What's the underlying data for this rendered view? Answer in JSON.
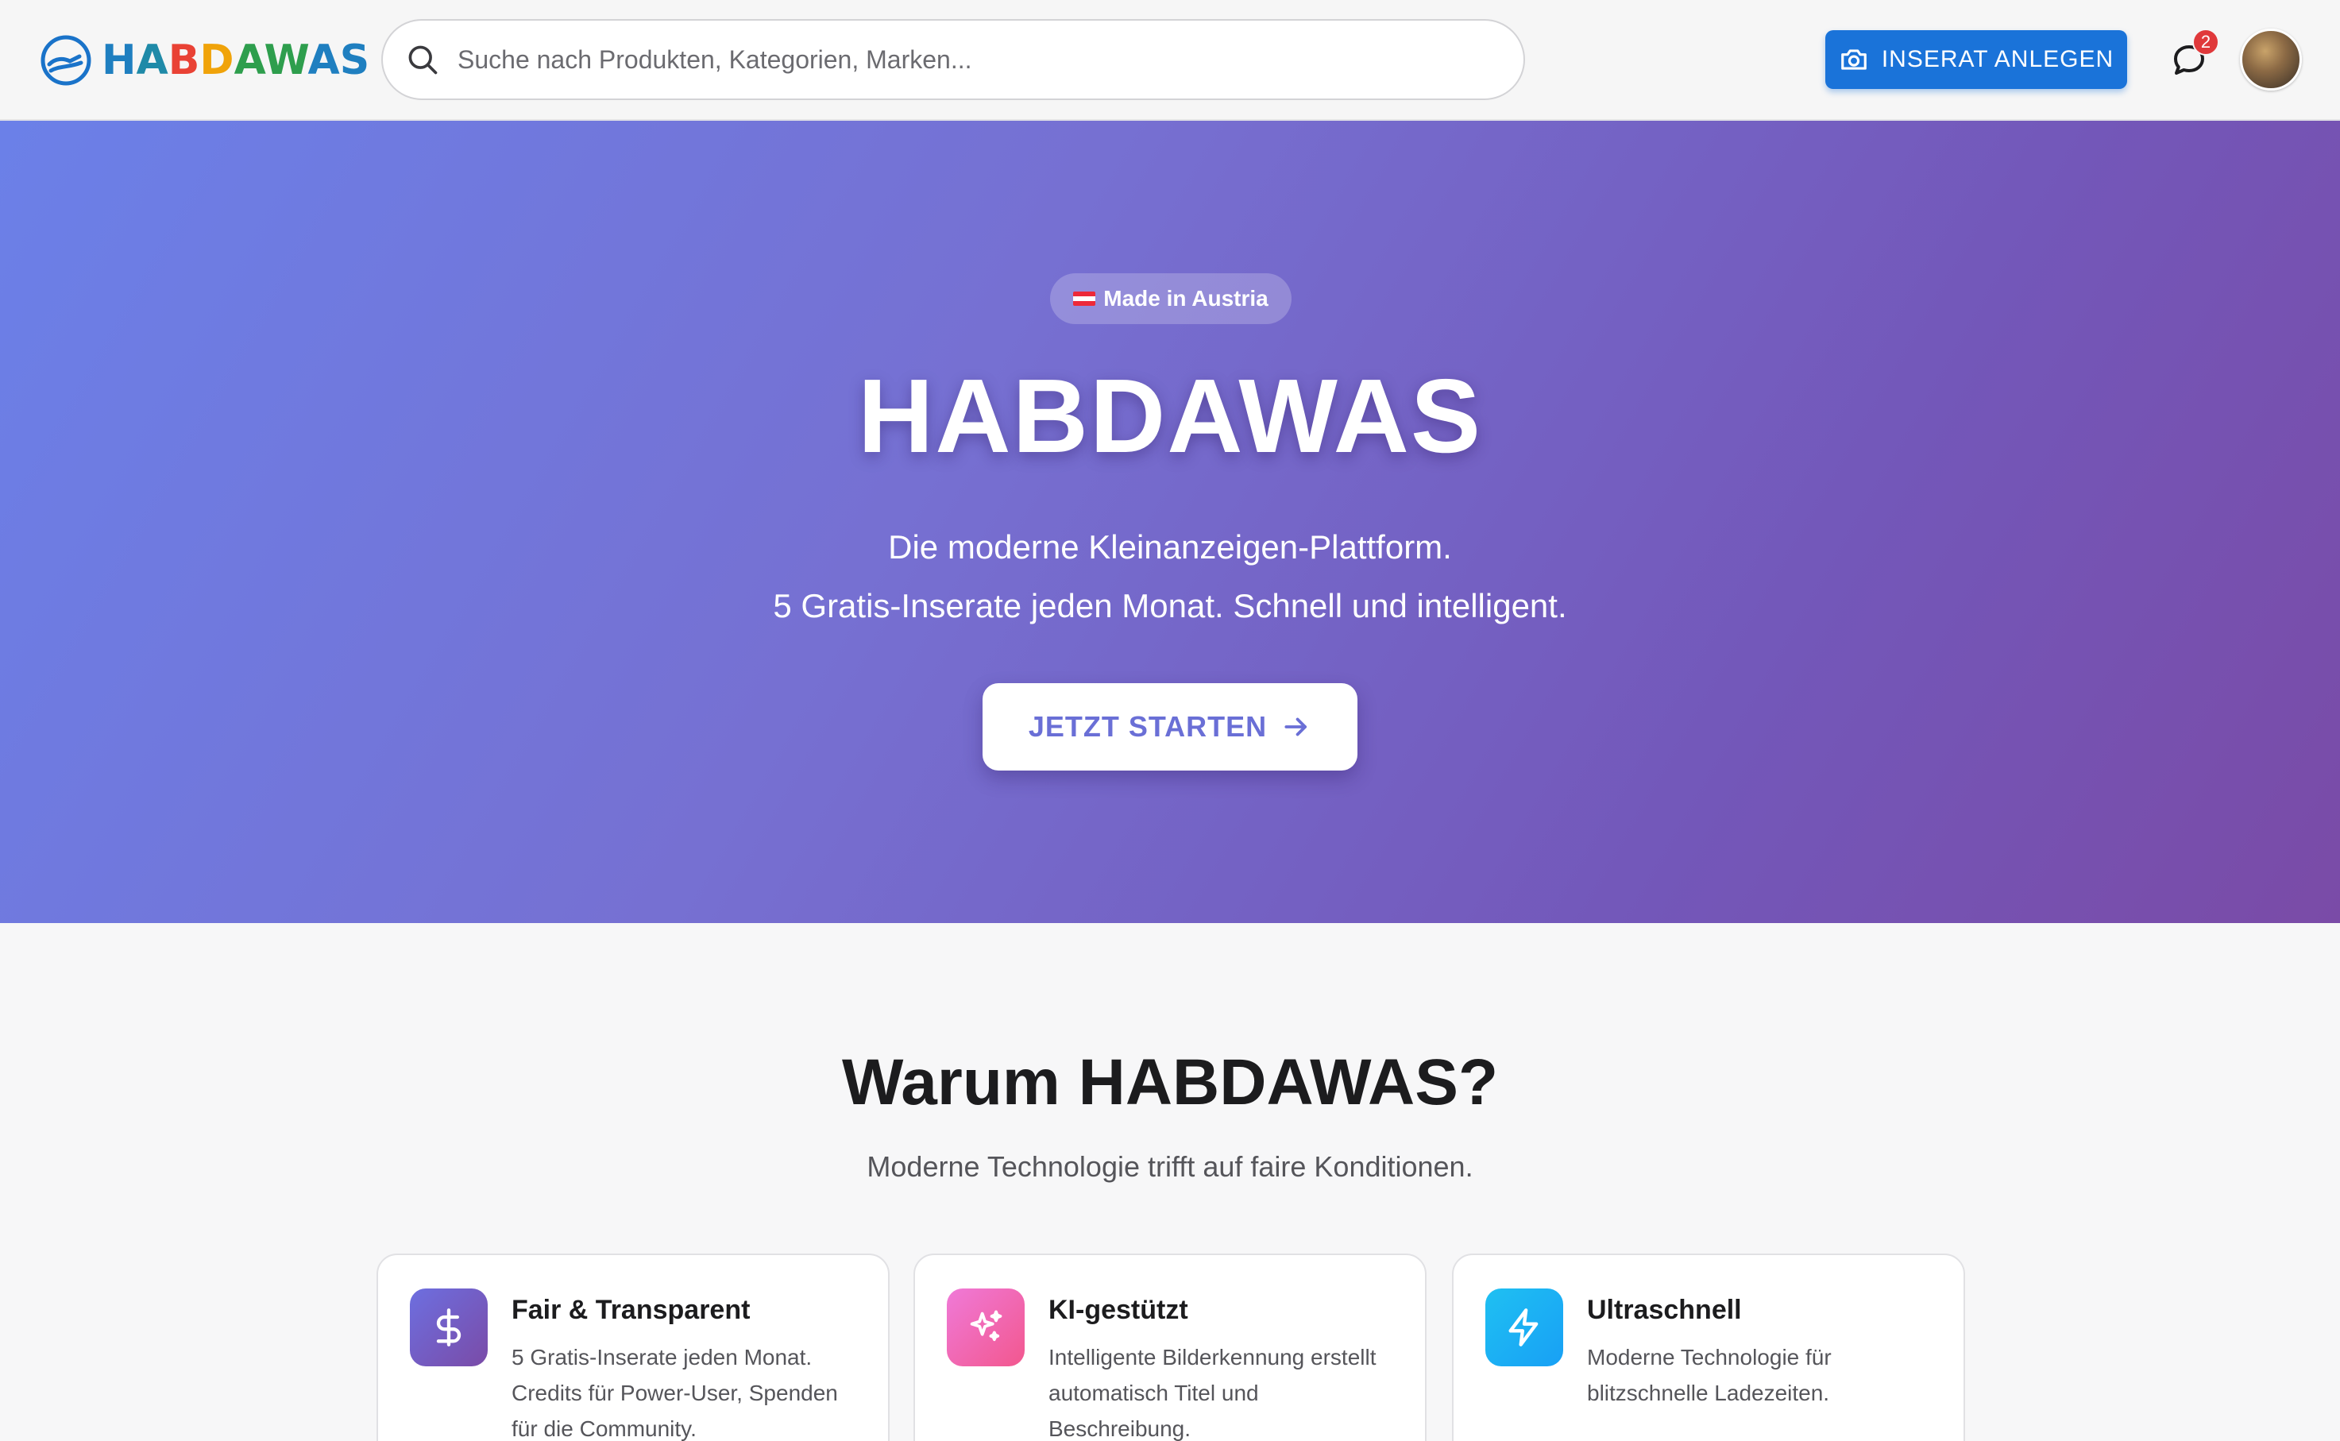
{
  "header": {
    "logo_text": "HABDAWAS",
    "search": {
      "placeholder": "Suche nach Produkten, Kategorien, Marken..."
    },
    "inserat_button_label": "INSERAT ANLEGEN",
    "message_badge_count": "2",
    "colors": {
      "primary_button": "#1a73d9",
      "badge": "#e0393b"
    }
  },
  "hero": {
    "chip_label": "Made in Austria",
    "title": "HABDAWAS",
    "subtitle_line1": "Die moderne Kleinanzeigen-Plattform.",
    "subtitle_line2": "5 Gratis-Inserate jeden Monat. Schnell und intelligent.",
    "cta_label": "JETZT STARTEN",
    "colors": {
      "gradient_start": "#6b80e8",
      "gradient_end": "#7a4ba7",
      "cta_text": "#6a6fd6"
    }
  },
  "why": {
    "title": "Warum HABDAWAS?",
    "subtitle": "Moderne Technologie trifft auf faire Konditionen.",
    "cards": [
      {
        "icon": "dollar-icon",
        "title": "Fair & Transparent",
        "text": "5 Gratis-Inserate jeden Monat. Credits für Power-User, Spenden für die Community.",
        "color": "#6a5acd"
      },
      {
        "icon": "sparkles-icon",
        "title": "KI-gestützt",
        "text": "Intelligente Bilderkennung erstellt automatisch Titel und Beschreibung.",
        "color": "#f2578e"
      },
      {
        "icon": "lightning-icon",
        "title": "Ultraschnell",
        "text": "Moderne Technologie für blitzschnelle Ladezeiten.",
        "color": "#18a6f5"
      }
    ]
  }
}
